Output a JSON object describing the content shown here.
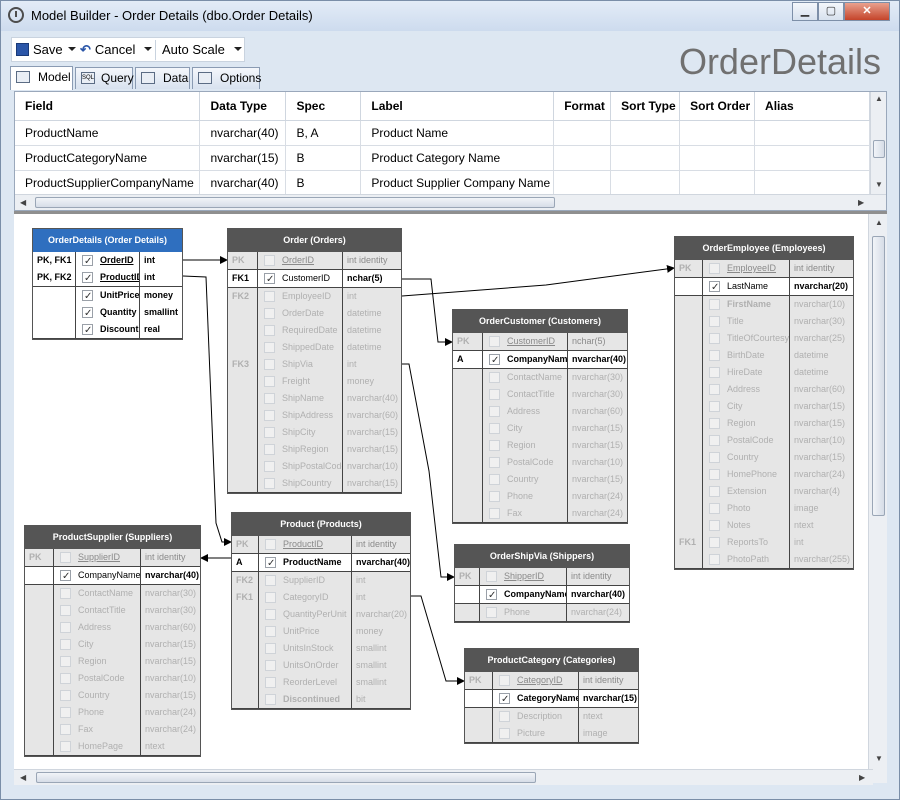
{
  "window": {
    "title": "Model Builder - Order Details (dbo.Order Details)"
  },
  "toolbar": {
    "save": "Save",
    "cancel": "Cancel",
    "autoscale": "Auto Scale"
  },
  "heading": "OrderDetails",
  "tabs": [
    "Model",
    "Query",
    "Data",
    "Options"
  ],
  "tab_icon_text": {
    "query": "SQL"
  },
  "fields_grid": {
    "headers": [
      "Field",
      "Data Type",
      "Spec",
      "Label",
      "Format",
      "Sort Type",
      "Sort Order",
      "Alias"
    ],
    "rows": [
      [
        "ProductName",
        "nvarchar(40)",
        "B, A",
        "Product Name",
        "",
        "",
        "",
        ""
      ],
      [
        "ProductCategoryName",
        "nvarchar(15)",
        "B",
        "Product Category Name",
        "",
        "",
        "",
        ""
      ],
      [
        "ProductSupplierCompanyName",
        "nvarchar(40)",
        "B",
        "Product Supplier Company Name",
        "",
        "",
        "",
        ""
      ]
    ]
  },
  "entities": [
    {
      "title": "OrderDetails (Order Details)",
      "selected": true,
      "sections": [
        {
          "gray": false,
          "rows": [
            {
              "k": "PK, FK1",
              "on": true,
              "n": "OrderID",
              "t": "int",
              "ul": true,
              "b": true
            },
            {
              "k": "PK, FK2",
              "on": true,
              "n": "ProductID",
              "t": "int",
              "ul": true,
              "b": true
            }
          ]
        },
        {
          "gray": false,
          "rows": [
            {
              "k": "",
              "on": true,
              "n": "UnitPrice",
              "t": "money",
              "b": true
            },
            {
              "k": "",
              "on": true,
              "n": "Quantity",
              "t": "smallint",
              "b": true
            },
            {
              "k": "",
              "on": true,
              "n": "Discount",
              "t": "real",
              "b": true
            }
          ]
        }
      ]
    },
    {
      "title": "Order (Orders)",
      "sections": [
        {
          "pk": true,
          "gray": true,
          "rows": [
            {
              "k": "PK",
              "n": "OrderID",
              "t": "int identity",
              "ul": true
            }
          ]
        },
        {
          "gray": false,
          "rows": [
            {
              "k": "FK1",
              "on": true,
              "n": "CustomerID",
              "t": "nchar(5)"
            }
          ]
        },
        {
          "gray": true,
          "rows": [
            {
              "k": "FK2",
              "n": "EmployeeID",
              "t": "int"
            },
            {
              "k": "",
              "n": "OrderDate",
              "t": "datetime"
            },
            {
              "k": "",
              "n": "RequiredDate",
              "t": "datetime"
            },
            {
              "k": "",
              "n": "ShippedDate",
              "t": "datetime"
            },
            {
              "k": "FK3",
              "n": "ShipVia",
              "t": "int"
            },
            {
              "k": "",
              "n": "Freight",
              "t": "money"
            },
            {
              "k": "",
              "n": "ShipName",
              "t": "nvarchar(40)"
            },
            {
              "k": "",
              "n": "ShipAddress",
              "t": "nvarchar(60)"
            },
            {
              "k": "",
              "n": "ShipCity",
              "t": "nvarchar(15)"
            },
            {
              "k": "",
              "n": "ShipRegion",
              "t": "nvarchar(15)"
            },
            {
              "k": "",
              "n": "ShipPostalCode",
              "t": "nvarchar(10)"
            },
            {
              "k": "",
              "n": "ShipCountry",
              "t": "nvarchar(15)"
            }
          ]
        }
      ]
    },
    {
      "title": "OrderCustomer (Customers)",
      "sections": [
        {
          "pk": true,
          "gray": true,
          "rows": [
            {
              "k": "PK",
              "n": "CustomerID",
              "t": "nchar(5)",
              "ul": true
            }
          ]
        },
        {
          "gray": false,
          "rows": [
            {
              "k": "A",
              "on": true,
              "n": "CompanyName",
              "t": "nvarchar(40)",
              "b": true
            }
          ]
        },
        {
          "gray": true,
          "rows": [
            {
              "k": "",
              "n": "ContactName",
              "t": "nvarchar(30)"
            },
            {
              "k": "",
              "n": "ContactTitle",
              "t": "nvarchar(30)"
            },
            {
              "k": "",
              "n": "Address",
              "t": "nvarchar(60)"
            },
            {
              "k": "",
              "n": "City",
              "t": "nvarchar(15)"
            },
            {
              "k": "",
              "n": "Region",
              "t": "nvarchar(15)"
            },
            {
              "k": "",
              "n": "PostalCode",
              "t": "nvarchar(10)"
            },
            {
              "k": "",
              "n": "Country",
              "t": "nvarchar(15)"
            },
            {
              "k": "",
              "n": "Phone",
              "t": "nvarchar(24)"
            },
            {
              "k": "",
              "n": "Fax",
              "t": "nvarchar(24)"
            }
          ]
        }
      ]
    },
    {
      "title": "OrderEmployee (Employees)",
      "sections": [
        {
          "pk": true,
          "gray": true,
          "rows": [
            {
              "k": "PK",
              "n": "EmployeeID",
              "t": "int identity",
              "ul": true
            }
          ]
        },
        {
          "gray": false,
          "rows": [
            {
              "k": "",
              "on": true,
              "n": "LastName",
              "t": "nvarchar(20)"
            }
          ]
        },
        {
          "gray": true,
          "rows": [
            {
              "k": "",
              "n": "FirstName",
              "t": "nvarchar(10)",
              "b": true
            },
            {
              "k": "",
              "n": "Title",
              "t": "nvarchar(30)"
            },
            {
              "k": "",
              "n": "TitleOfCourtesy",
              "t": "nvarchar(25)"
            },
            {
              "k": "",
              "n": "BirthDate",
              "t": "datetime"
            },
            {
              "k": "",
              "n": "HireDate",
              "t": "datetime"
            },
            {
              "k": "",
              "n": "Address",
              "t": "nvarchar(60)"
            },
            {
              "k": "",
              "n": "City",
              "t": "nvarchar(15)"
            },
            {
              "k": "",
              "n": "Region",
              "t": "nvarchar(15)"
            },
            {
              "k": "",
              "n": "PostalCode",
              "t": "nvarchar(10)"
            },
            {
              "k": "",
              "n": "Country",
              "t": "nvarchar(15)"
            },
            {
              "k": "",
              "n": "HomePhone",
              "t": "nvarchar(24)"
            },
            {
              "k": "",
              "n": "Extension",
              "t": "nvarchar(4)"
            },
            {
              "k": "",
              "n": "Photo",
              "t": "image"
            },
            {
              "k": "",
              "n": "Notes",
              "t": "ntext"
            },
            {
              "k": "FK1",
              "n": "ReportsTo",
              "t": "int"
            },
            {
              "k": "",
              "n": "PhotoPath",
              "t": "nvarchar(255)"
            }
          ]
        }
      ]
    },
    {
      "title": "ProductSupplier (Suppliers)",
      "sections": [
        {
          "pk": true,
          "gray": true,
          "rows": [
            {
              "k": "PK",
              "n": "SupplierID",
              "t": "int identity",
              "ul": true
            }
          ]
        },
        {
          "gray": false,
          "rows": [
            {
              "k": "",
              "on": true,
              "n": "CompanyName",
              "t": "nvarchar(40)"
            }
          ]
        },
        {
          "gray": true,
          "rows": [
            {
              "k": "",
              "n": "ContactName",
              "t": "nvarchar(30)"
            },
            {
              "k": "",
              "n": "ContactTitle",
              "t": "nvarchar(30)"
            },
            {
              "k": "",
              "n": "Address",
              "t": "nvarchar(60)"
            },
            {
              "k": "",
              "n": "City",
              "t": "nvarchar(15)"
            },
            {
              "k": "",
              "n": "Region",
              "t": "nvarchar(15)"
            },
            {
              "k": "",
              "n": "PostalCode",
              "t": "nvarchar(10)"
            },
            {
              "k": "",
              "n": "Country",
              "t": "nvarchar(15)"
            },
            {
              "k": "",
              "n": "Phone",
              "t": "nvarchar(24)"
            },
            {
              "k": "",
              "n": "Fax",
              "t": "nvarchar(24)"
            },
            {
              "k": "",
              "n": "HomePage",
              "t": "ntext"
            }
          ]
        }
      ]
    },
    {
      "title": "Product (Products)",
      "sections": [
        {
          "pk": true,
          "gray": true,
          "rows": [
            {
              "k": "PK",
              "n": "ProductID",
              "t": "int identity",
              "ul": true
            }
          ]
        },
        {
          "gray": false,
          "rows": [
            {
              "k": "A",
              "on": true,
              "n": "ProductName",
              "t": "nvarchar(40)",
              "b": true
            }
          ]
        },
        {
          "gray": true,
          "rows": [
            {
              "k": "FK2",
              "n": "SupplierID",
              "t": "int"
            },
            {
              "k": "FK1",
              "n": "CategoryID",
              "t": "int"
            },
            {
              "k": "",
              "n": "QuantityPerUnit",
              "t": "nvarchar(20)"
            },
            {
              "k": "",
              "n": "UnitPrice",
              "t": "money"
            },
            {
              "k": "",
              "n": "UnitsInStock",
              "t": "smallint"
            },
            {
              "k": "",
              "n": "UnitsOnOrder",
              "t": "smallint"
            },
            {
              "k": "",
              "n": "ReorderLevel",
              "t": "smallint"
            },
            {
              "k": "",
              "n": "Discontinued",
              "t": "bit",
              "b": true
            }
          ]
        }
      ]
    },
    {
      "title": "OrderShipVia (Shippers)",
      "sections": [
        {
          "pk": true,
          "gray": true,
          "rows": [
            {
              "k": "PK",
              "n": "ShipperID",
              "t": "int identity",
              "ul": true
            }
          ]
        },
        {
          "gray": false,
          "rows": [
            {
              "k": "",
              "on": true,
              "n": "CompanyName",
              "t": "nvarchar(40)",
              "b": true
            }
          ]
        },
        {
          "gray": true,
          "rows": [
            {
              "k": "",
              "n": "Phone",
              "t": "nvarchar(24)"
            }
          ]
        }
      ]
    },
    {
      "title": "ProductCategory (Categories)",
      "sections": [
        {
          "pk": true,
          "gray": true,
          "rows": [
            {
              "k": "PK",
              "n": "CategoryID",
              "t": "int identity",
              "ul": true
            }
          ]
        },
        {
          "gray": false,
          "rows": [
            {
              "k": "",
              "on": true,
              "n": "CategoryName",
              "t": "nvarchar(15)",
              "b": true
            }
          ]
        },
        {
          "gray": true,
          "rows": [
            {
              "k": "",
              "n": "Description",
              "t": "ntext"
            },
            {
              "k": "",
              "n": "Picture",
              "t": "image"
            }
          ]
        }
      ]
    }
  ]
}
